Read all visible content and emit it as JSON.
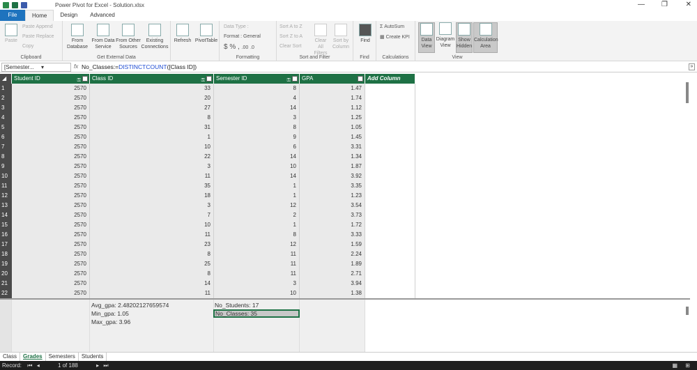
{
  "window": {
    "title": "Power Pivot for Excel - Solution.xlsx"
  },
  "ribbon_tabs": [
    "File",
    "Home",
    "Design",
    "Advanced"
  ],
  "ribbon": {
    "clipboard": {
      "label": "Clipboard",
      "paste": "Paste",
      "paste_append": "Paste Append",
      "paste_replace": "Paste Replace",
      "copy": "Copy"
    },
    "external": {
      "label": "Get External Data",
      "from_database": "From Database",
      "from_data_service": "From Data Service",
      "from_other_sources": "From Other Sources",
      "existing_connections": "Existing Connections"
    },
    "refresh": "Refresh",
    "pivottable": "PivotTable",
    "formatting": {
      "label": "Formatting",
      "data_type": "Data Type :",
      "format": "Format : General",
      "currency": "$",
      "percent": "%",
      "comma": ",",
      "inc_dec": ".00",
      "dec_dec": ".0"
    },
    "sort": {
      "label": "Sort and Filter",
      "sort_az": "Sort A to Z",
      "sort_za": "Sort Z to A",
      "clear_sort": "Clear Sort",
      "clear_filters": "Clear All Filters",
      "sort_by_column": "Sort by Column"
    },
    "find": {
      "label": "Find",
      "find": "Find"
    },
    "calculations": {
      "label": "Calculations",
      "autosum": "AutoSum",
      "create_kpi": "Create KPI"
    },
    "view": {
      "label": "View",
      "data_view": "Data View",
      "diagram_view": "Diagram View",
      "show_hidden": "Show Hidden",
      "calculation_area": "Calculation Area"
    }
  },
  "formula_bar": {
    "name_box": "[Semester...",
    "fx": "fx",
    "prefix": "No_Classes:=",
    "function": "DISTINCTCOUNT",
    "args": "([Class ID])"
  },
  "table": {
    "columns": [
      "Student ID",
      "Class ID",
      "Semester ID",
      "GPA",
      "Add Column"
    ],
    "rows": [
      [
        "1",
        "2570",
        "33",
        "8",
        "1.47"
      ],
      [
        "2",
        "2570",
        "20",
        "4",
        "1.74"
      ],
      [
        "3",
        "2570",
        "27",
        "14",
        "1.12"
      ],
      [
        "4",
        "2570",
        "8",
        "3",
        "1.25"
      ],
      [
        "5",
        "2570",
        "31",
        "8",
        "1.05"
      ],
      [
        "6",
        "2570",
        "1",
        "9",
        "1.45"
      ],
      [
        "7",
        "2570",
        "10",
        "6",
        "3.31"
      ],
      [
        "8",
        "2570",
        "22",
        "14",
        "1.34"
      ],
      [
        "9",
        "2570",
        "3",
        "10",
        "1.87"
      ],
      [
        "10",
        "2570",
        "11",
        "14",
        "3.92"
      ],
      [
        "11",
        "2570",
        "35",
        "1",
        "3.35"
      ],
      [
        "12",
        "2570",
        "18",
        "1",
        "1.23"
      ],
      [
        "13",
        "2570",
        "3",
        "12",
        "3.54"
      ],
      [
        "14",
        "2570",
        "7",
        "2",
        "3.73"
      ],
      [
        "15",
        "2570",
        "10",
        "1",
        "1.72"
      ],
      [
        "16",
        "2570",
        "11",
        "8",
        "3.33"
      ],
      [
        "17",
        "2570",
        "23",
        "12",
        "1.59"
      ],
      [
        "18",
        "2570",
        "8",
        "11",
        "2.24"
      ],
      [
        "19",
        "2570",
        "25",
        "11",
        "1.89"
      ],
      [
        "20",
        "2570",
        "8",
        "11",
        "2.71"
      ],
      [
        "21",
        "2570",
        "14",
        "3",
        "3.94"
      ],
      [
        "22",
        "2570",
        "11",
        "10",
        "1.38"
      ]
    ]
  },
  "measures": {
    "avg": "Avg_gpa: 2.48202127659574",
    "min": "Min_gpa: 1.05",
    "max": "Max_gpa: 3.96",
    "students": "No_Students: 17",
    "classes": "No_Classes: 35"
  },
  "sheet_tabs": [
    "Class",
    "Grades",
    "Semesters",
    "Students"
  ],
  "status": {
    "record_label": "Record:",
    "record": "1 of 188"
  }
}
